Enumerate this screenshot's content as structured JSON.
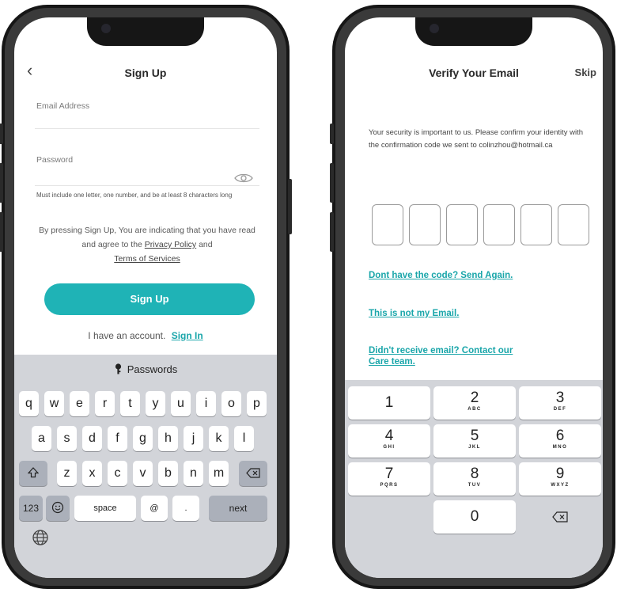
{
  "signup": {
    "title": "Sign Up",
    "back_icon": "chevron-left-icon",
    "email_label": "Email Address",
    "password_label": "Password",
    "password_hint": "Must include one letter, one number, and be at least 8 characters long",
    "legal_prefix": "By pressing Sign Up, You are indicating that you have read and agree to the",
    "privacy_link": "Privacy Policy",
    "legal_and": "and",
    "terms_link": "Terms of Services",
    "cta_label": "Sign Up",
    "have_account": "I have an account.",
    "signin_link": "Sign In",
    "accent_color": "#1fb3b6"
  },
  "keyboard": {
    "bar_label": "Passwords",
    "bar_icon": "key-icon",
    "row1": [
      "q",
      "w",
      "e",
      "r",
      "t",
      "y",
      "u",
      "i",
      "o",
      "p"
    ],
    "row2": [
      "a",
      "s",
      "d",
      "f",
      "g",
      "h",
      "j",
      "k",
      "l"
    ],
    "row3": [
      "z",
      "x",
      "c",
      "v",
      "b",
      "n",
      "m"
    ],
    "shift_icon": "shift-icon",
    "backspace_icon": "backspace-icon",
    "num_label": "123",
    "emoji_icon": "emoji-icon",
    "space_label": "space",
    "at_label": "@",
    "dot_label": ".",
    "next_label": "next",
    "globe_icon": "globe-icon"
  },
  "verify": {
    "title": "Verify Your Email",
    "skip_label": "Skip",
    "message": "Your security is important to us. Please confirm your identity with the confirmation code we sent to colinzhou@hotmail.ca",
    "code_length": 6,
    "resend_link": "Dont have the code? Send Again.",
    "not_my_email_link": "This is not my Email.",
    "contact_link_line1": "Didn't receive email? Contact our",
    "contact_link_line2": "Care team."
  },
  "numpad": {
    "keys": [
      {
        "digit": "1",
        "letters": ""
      },
      {
        "digit": "2",
        "letters": "ABC"
      },
      {
        "digit": "3",
        "letters": "DEF"
      },
      {
        "digit": "4",
        "letters": "GHI"
      },
      {
        "digit": "5",
        "letters": "JKL"
      },
      {
        "digit": "6",
        "letters": "MNO"
      },
      {
        "digit": "7",
        "letters": "PQRS"
      },
      {
        "digit": "8",
        "letters": "TUV"
      },
      {
        "digit": "9",
        "letters": "WXYZ"
      }
    ],
    "zero": "0",
    "delete_icon": "backspace-icon"
  }
}
